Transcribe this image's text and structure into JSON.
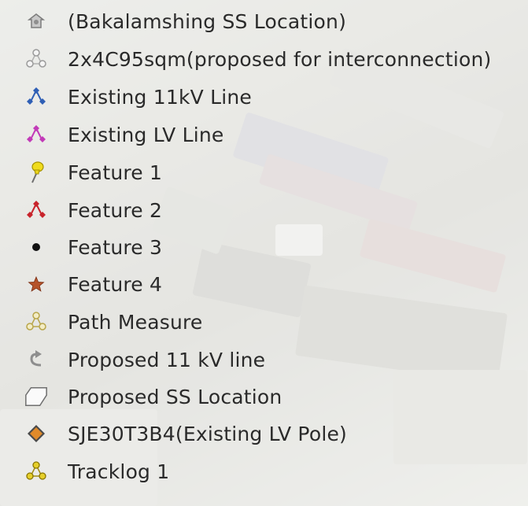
{
  "legend": {
    "items": [
      {
        "label": "(Bakalamshing SS Location)",
        "icon": "house-placemark-icon",
        "color": "#9a9a9a"
      },
      {
        "label": "2x4C95sqm(proposed for interconnection)",
        "icon": "path-nodes-icon",
        "color": "#b8b8b8"
      },
      {
        "label": "Existing 11kV Line",
        "icon": "path-nodes-icon",
        "color": "#2f5fb5"
      },
      {
        "label": "Existing LV Line",
        "icon": "path-nodes-icon",
        "color": "#c23ab8"
      },
      {
        "label": "Feature 1",
        "icon": "pushpin-icon",
        "color": "#e8d21a"
      },
      {
        "label": "Feature 2",
        "icon": "path-nodes-icon",
        "color": "#c8232b"
      },
      {
        "label": "Feature 3",
        "icon": "dot-icon",
        "color": "#111111"
      },
      {
        "label": "Feature 4",
        "icon": "star-icon",
        "color": "#b5532a"
      },
      {
        "label": "Path Measure",
        "icon": "path-nodes-icon",
        "color": "#d9c35a"
      },
      {
        "label": "Proposed 11 kV line",
        "icon": "curved-arrow-icon",
        "color": "#9a9a9a"
      },
      {
        "label": "Proposed SS Location",
        "icon": "polygon-icon",
        "color": "#8a8a8a"
      },
      {
        "label": "SJE30T3B4(Existing LV Pole)",
        "icon": "diamond-icon",
        "color": "#e08a2a"
      },
      {
        "label": "Tracklog 1",
        "icon": "path-nodes-icon",
        "color": "#d9c020"
      }
    ]
  }
}
